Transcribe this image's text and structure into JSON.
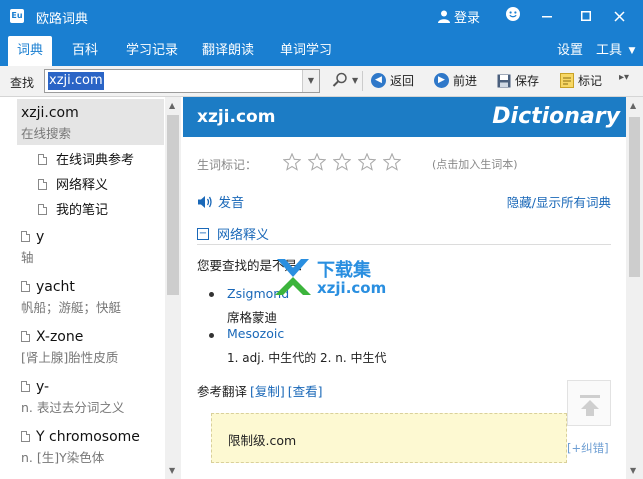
{
  "window": {
    "title": "欧路词典",
    "icon_text": "Eu",
    "login_label": "登录"
  },
  "tabs": [
    "词典",
    "百科",
    "学习记录",
    "翻译朗读",
    "单词学习"
  ],
  "tab_right": {
    "settings": "设置",
    "tools": "工具"
  },
  "toolbar": {
    "search_label": "查找",
    "search_value": "xzji.com",
    "back_label": "返回",
    "forward_label": "前进",
    "save_label": "保存",
    "mark_label": "标记"
  },
  "left_list": {
    "selected": {
      "word": "xzji.com",
      "def": "在线搜索"
    },
    "sub_items": [
      "在线词典参考",
      "网络释义",
      "我的笔记"
    ],
    "entries": [
      {
        "word": "y",
        "def": "轴"
      },
      {
        "word": "yacht",
        "def": "帆船；游艇；快艇"
      },
      {
        "word": "X-zone",
        "def": "[肾上腺]胎性皮质"
      },
      {
        "word": "y-",
        "def": "n. 表过去分词之义"
      },
      {
        "word": "Y chromosome",
        "def": "n. [生]Y染色体"
      }
    ]
  },
  "content": {
    "headword": "xzji.com",
    "dictionary_label": "Dictionary",
    "mark_label": "生词标记：",
    "mark_hint": "(点击加入生词本)",
    "pronounce_label": "发音",
    "toggle_all": "隐藏/显示所有词典",
    "section_title": "网络释义",
    "intro": "您要查找的是不是：",
    "suggestions": [
      {
        "word": "Zsigmond",
        "def": "席格蒙迪"
      },
      {
        "word": "Mesozoic",
        "def": "1. adj. 中生代的 2. n. 中生代"
      }
    ],
    "ref_label": "参考翻译",
    "ref_copy": "[复制]",
    "ref_view": "[查看]",
    "ref_text": "限制级.com",
    "correction": "[+纠错]"
  },
  "watermark": {
    "text_cn": "下载集",
    "text_url": "xzji.com"
  },
  "colors": {
    "brand": "#1a7fd1",
    "header": "#1c7cc5",
    "link": "#1a68b8",
    "ref_bg": "#fdf9d2"
  }
}
